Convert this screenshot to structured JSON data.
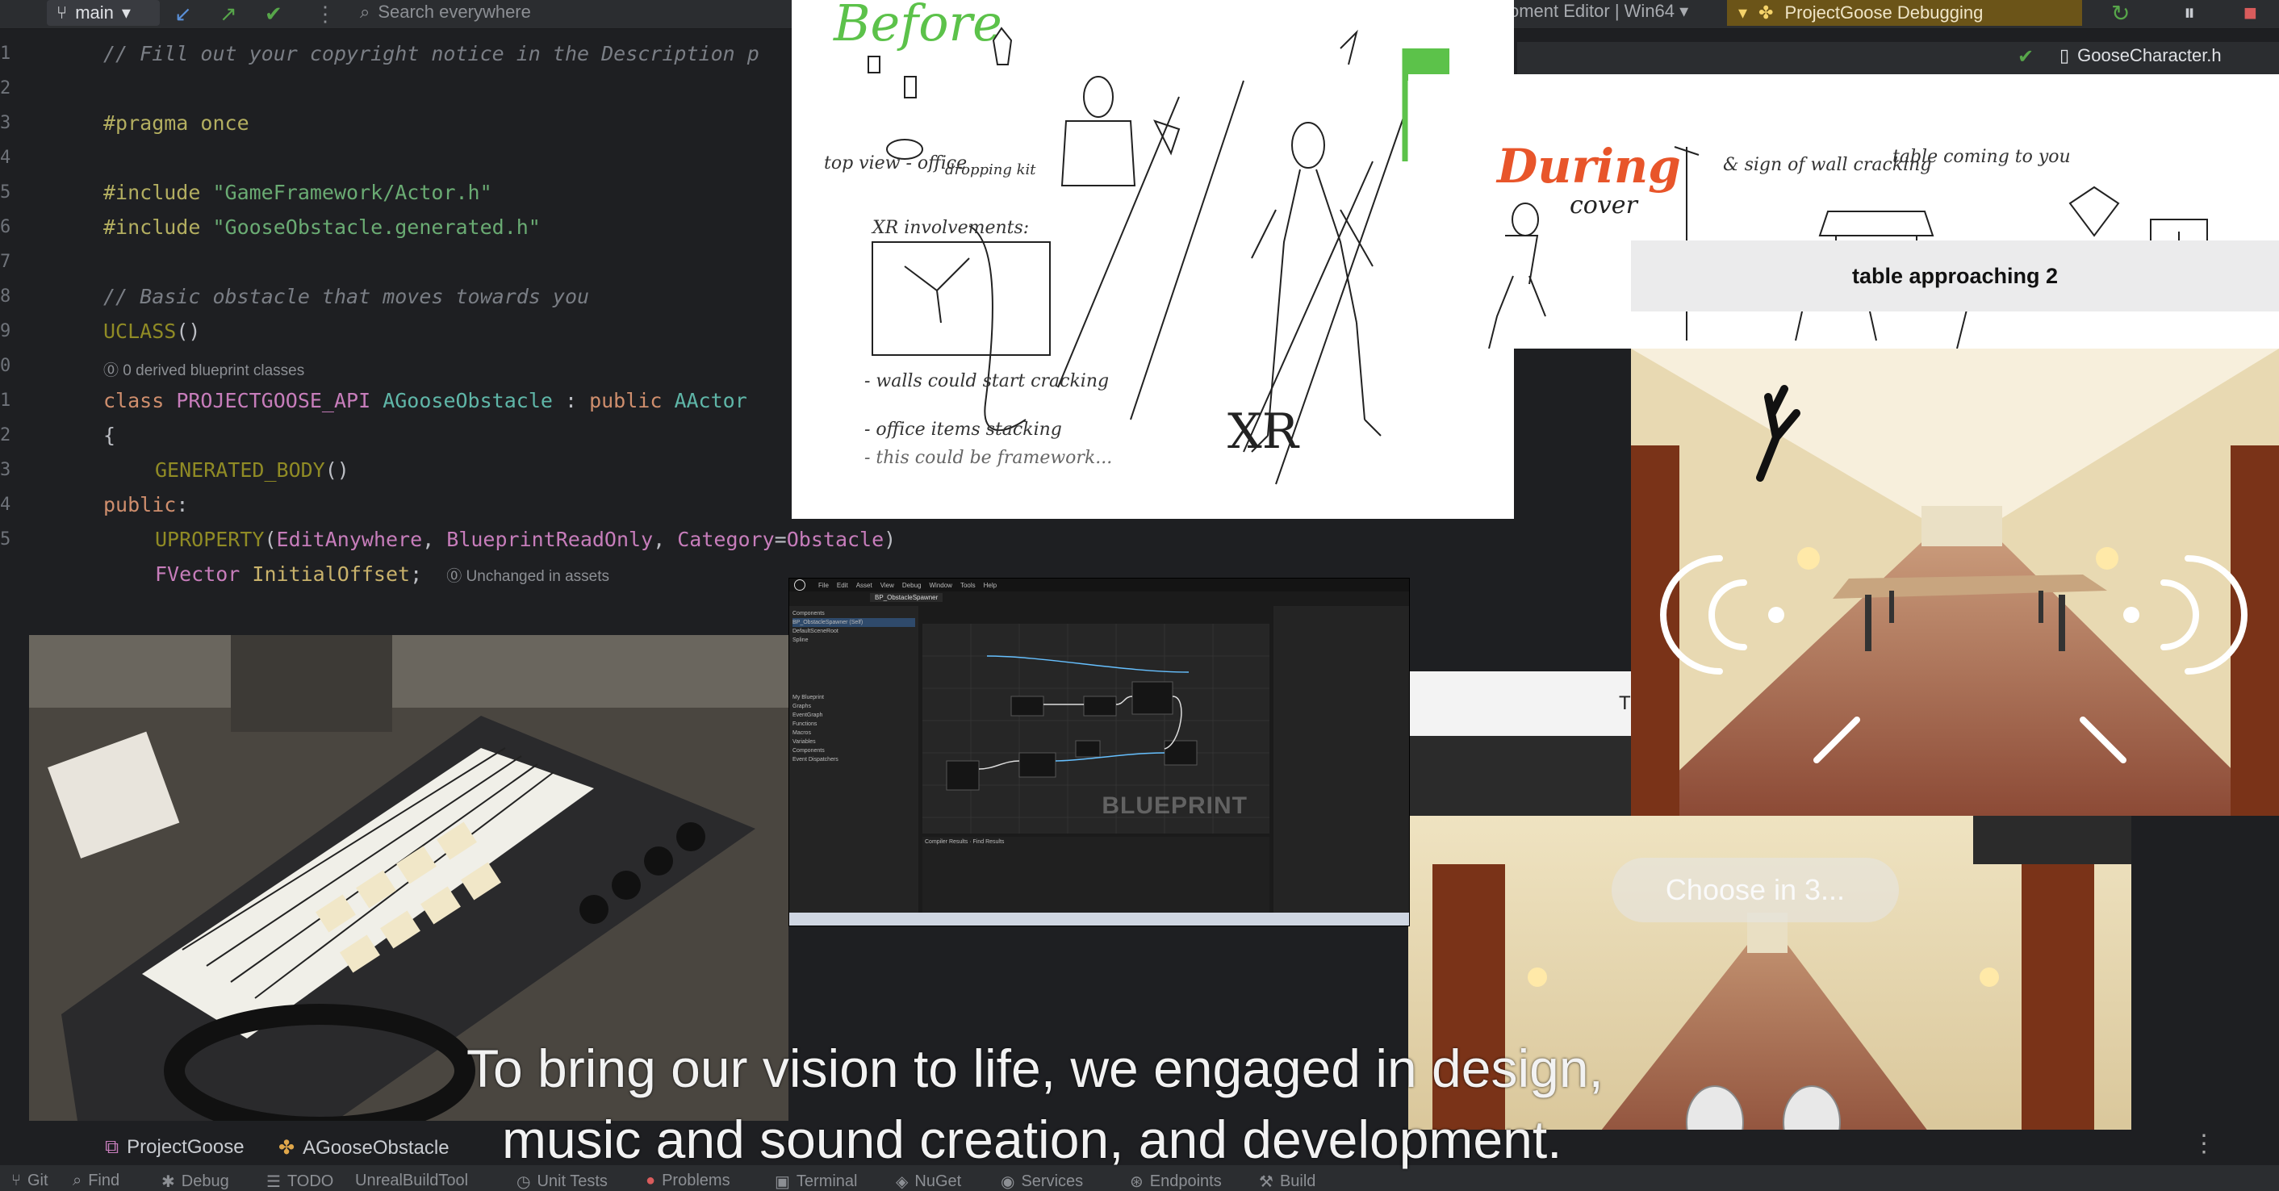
{
  "ide": {
    "branch": "main",
    "search_placeholder": "Search everywhere",
    "editor_title": "oment Editor | Win64",
    "run_config": "ProjectGoose Debugging",
    "open_file_tab": "GooseCharacter.h",
    "code": {
      "l1": "// Fill out your copyright notice in the Description p",
      "l2_kw": "#pragma",
      "l2_rest": " once",
      "l3_kw": "#include",
      "l3_str": " \"GameFramework/Actor.h\"",
      "l4_kw": "#include",
      "l4_str": " \"GooseObstacle.generated.h\"",
      "l5": "// Basic obstacle that moves towards you",
      "l6_macro": "UCLASS",
      "l6_rest": "()",
      "hint_derived": "0 derived blueprint classes",
      "l7_kw": "class",
      "l7_api": " PROJECTGOOSE_API ",
      "l7_name": "AGooseObstacle",
      "l7_rest": " : ",
      "l7_pub": "public",
      "l7_base": " AActor",
      "l8": "{",
      "l9_macro": "GENERATED_BODY",
      "l9_rest": "()",
      "l10_kw": "public",
      "l10_rest": ":",
      "l11_macro": "UPROPERTY",
      "l11_open": "(",
      "l11_a": "EditAnywhere",
      "l11_sep1": ", ",
      "l11_b": "BlueprintReadOnly",
      "l11_sep2": ", ",
      "l11_c": "Category",
      "l11_eq": "=",
      "l11_d": "Obstacle",
      "l11_close": ")",
      "l12_type": "FVector",
      "l12_name": " InitialOffset",
      "l12_semi": ";",
      "hint_unchanged": "Unchanged in assets"
    },
    "bottom_tabs": [
      "ProjectGoose",
      "AGooseObstacle"
    ],
    "status_items": [
      "Git",
      "Find",
      "Debug",
      "TODO",
      "UnrealBuildTool",
      "Unit Tests",
      "Problems",
      "Terminal",
      "NuGet",
      "Services",
      "Endpoints",
      "Build"
    ]
  },
  "sketch": {
    "before_label": "Before",
    "during_label": "During",
    "xr_label": "XR",
    "cover_label": "cover",
    "notes": [
      "top view - office",
      "dropping kit",
      "XR involvements:",
      "- walls could start cracking",
      "- office items stacking",
      "- this could be framework...",
      "& sign of wall cracking",
      "table coming to you"
    ]
  },
  "table_caption": "table approaching 2",
  "choose_prompt": "Choose in 3...",
  "blueprint": {
    "watermark": "BLUEPRINT",
    "menu": [
      "File",
      "Edit",
      "Asset",
      "View",
      "Debug",
      "Window",
      "Tools",
      "Help"
    ],
    "tab": "BP_ObstacleSpawner",
    "panel_items": [
      "Components",
      "BP_ObstacleSpawner (Self)",
      "DefaultSceneRoot",
      "Spline",
      "My Blueprint",
      "Graphs",
      "EventGraph",
      "Functions",
      "Macros",
      "Variables",
      "Components",
      "Event Dispatchers",
      "Compiler Results",
      "Find Results"
    ]
  },
  "caption": {
    "line1": "To bring our vision to life, we engaged in design,",
    "line2": "music and sound creation, and development."
  },
  "colors": {
    "ide_bg": "#1e1f22",
    "run_config_bg": "#6b5418",
    "before_green": "#5cc24a",
    "during_orange": "#e8552a"
  }
}
